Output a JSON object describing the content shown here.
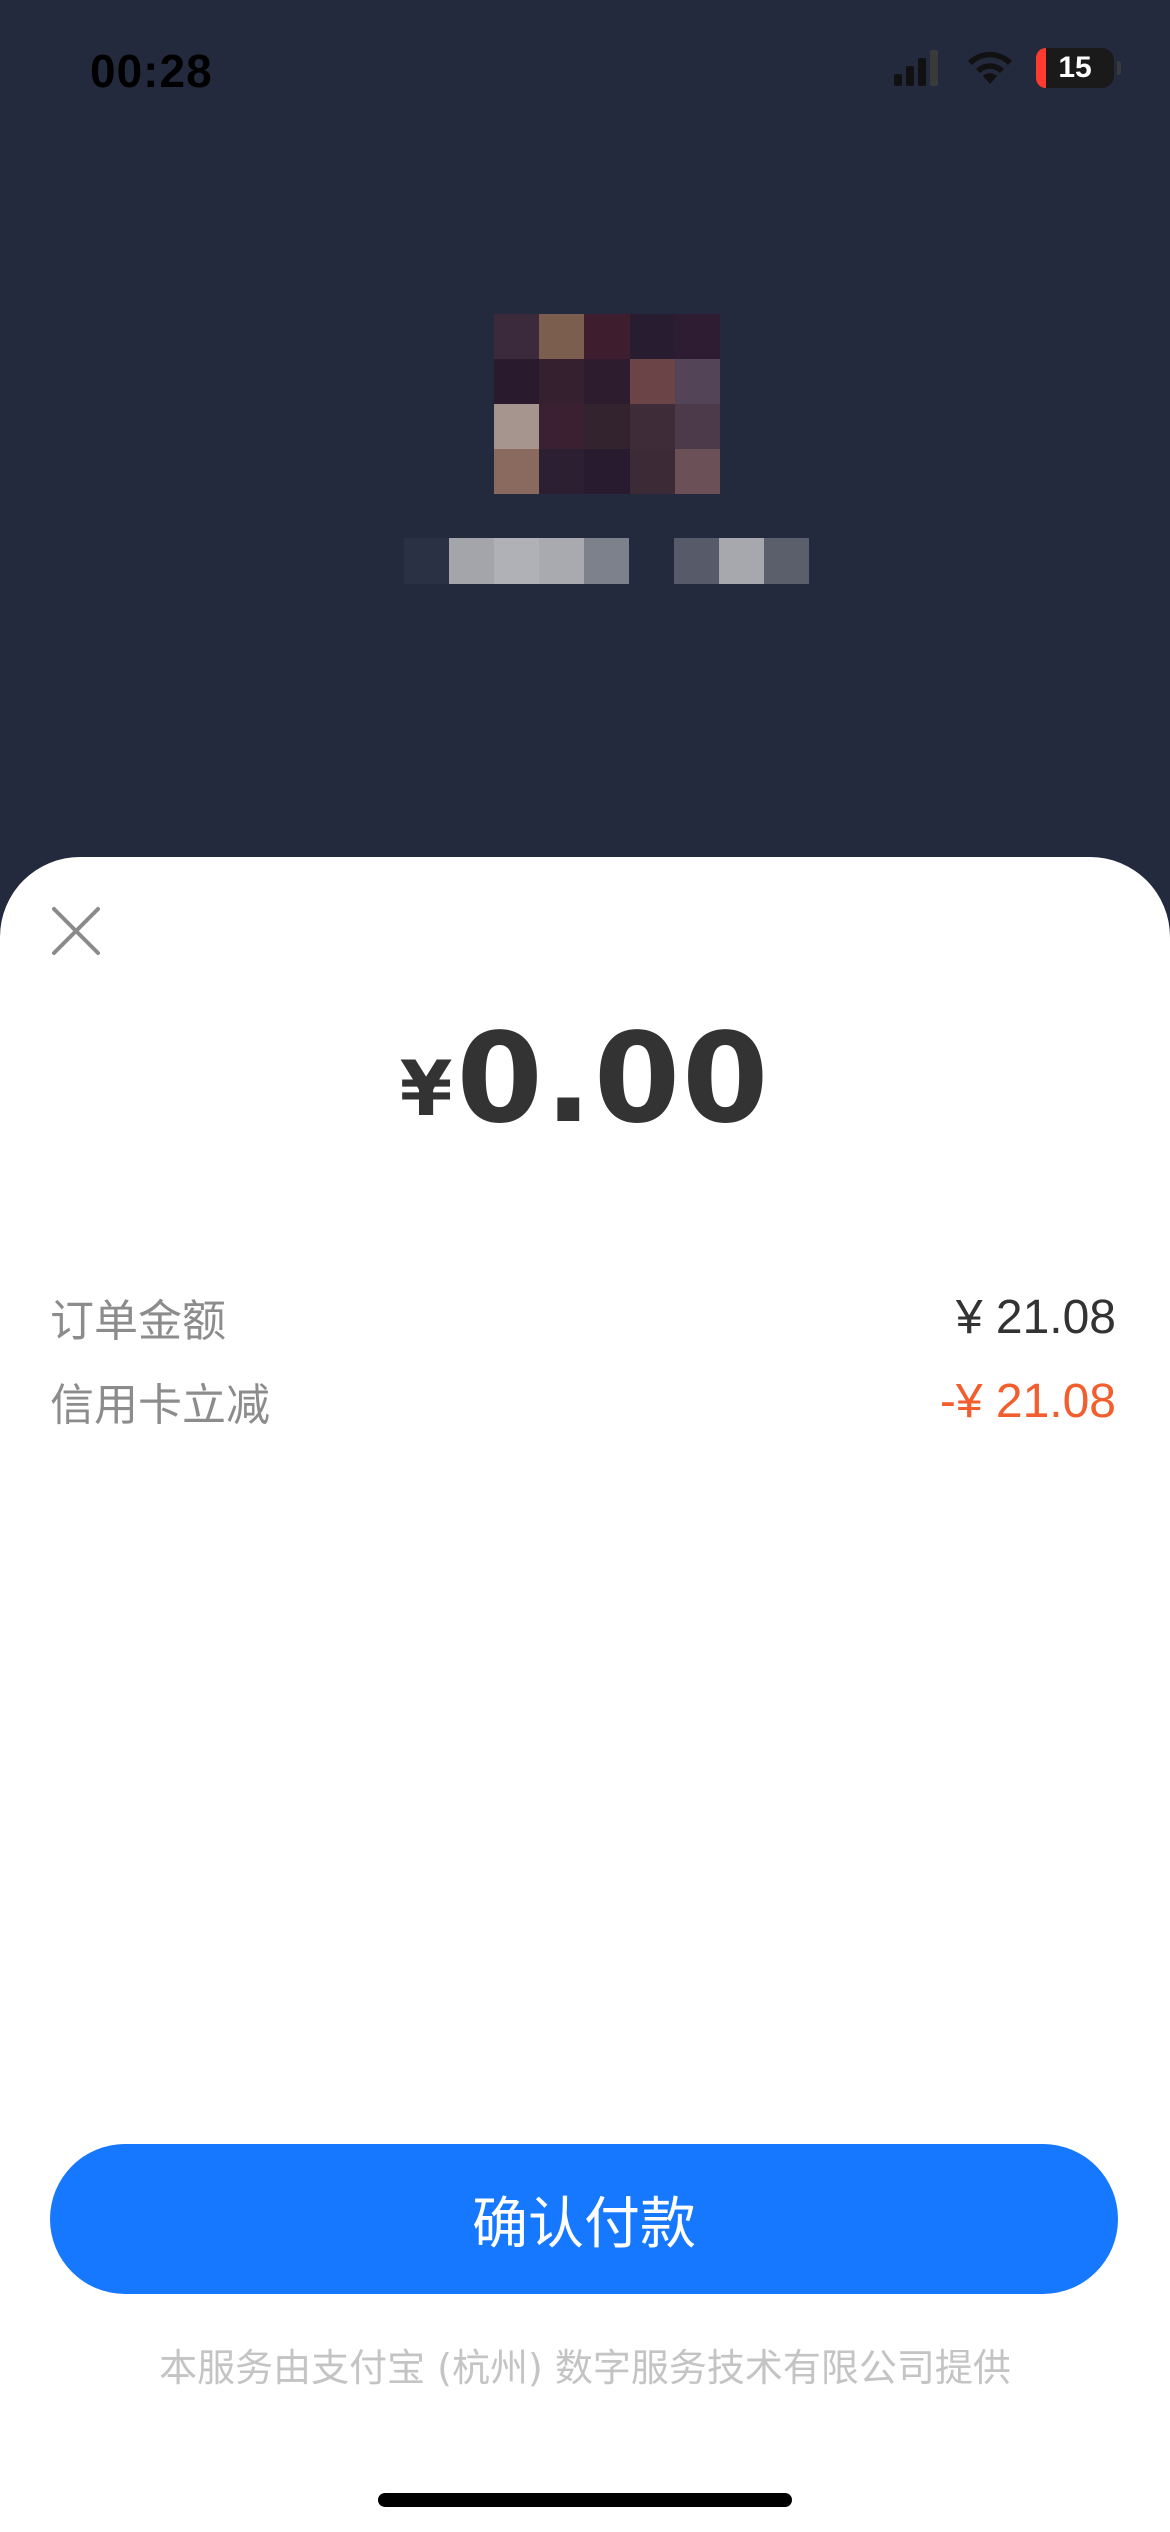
{
  "status_bar": {
    "time": "00:28",
    "battery_level": "15",
    "signal_icon": "cellular-signal-icon",
    "wifi_icon": "wifi-icon"
  },
  "merchant": {
    "avatar_pixels": [
      "#3b2a3c",
      "#7b5e4e",
      "#3e1e2e",
      "#271c30",
      "#2e1c32",
      "#2a1a2e",
      "#34202f",
      "#2d1c2e",
      "#6a4446",
      "#544458",
      "#a6958f",
      "#3a2030",
      "#33232f",
      "#3e2d38",
      "#4c3a4a",
      "#8a6a5e",
      "#2d1f32",
      "#281a2f",
      "#3d2a37",
      "#6b5058"
    ],
    "name_pixels": [
      "#2b3144",
      "#a3a5ab",
      "#b0b1b6",
      "#a9aab0",
      "#7d818c",
      "#242a3d",
      "#575b69",
      "#a7a8ad",
      "#5b5f6b"
    ]
  },
  "sheet": {
    "close_icon": "close-icon",
    "amount_currency": "¥",
    "amount_value": "0.00",
    "rows": [
      {
        "label": "订单金额",
        "value": "¥ 21.08"
      },
      {
        "label": "信用卡立减",
        "value": "-¥ 21.08"
      }
    ],
    "confirm_label": "确认付款",
    "footer_note": "本服务由支付宝 (杭州) 数字服务技术有限公司提供"
  },
  "colors": {
    "background": "#242a3d",
    "primary": "#1677ff",
    "discount": "#f25e2e",
    "battery_low": "#ff3b30"
  }
}
